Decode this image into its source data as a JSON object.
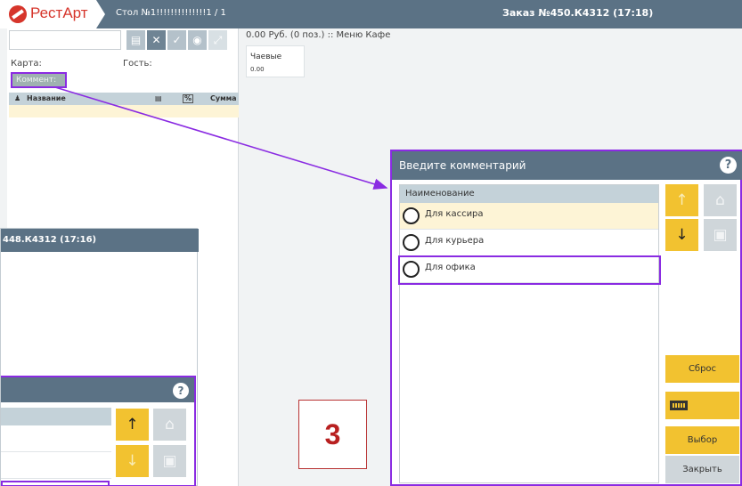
{
  "header": {
    "app_name": "РестАрт",
    "table_label": "Стол №1!!!!!!!!!!!!!!1 / 1",
    "order_title": "Заказ №450.К4312 (17:18)"
  },
  "order_panel": {
    "search_value": "",
    "card_label": "Карта:",
    "guest_label": "Гость:",
    "comment_button": "Коммент:",
    "columns": {
      "name": "Название",
      "percent": "%",
      "sum": "Сумма"
    }
  },
  "summary": {
    "text": "0.00 Руб. (0 поз.) :: Меню Кафе",
    "tips_label": "Чаевые",
    "tips_value": "0.00"
  },
  "window2": {
    "title": "448.К4312 (17:16)"
  },
  "dialog": {
    "title": "Введите комментарий",
    "list_header": "Наименование",
    "items": [
      {
        "label": "Для кассира"
      },
      {
        "label": "Для курьера"
      },
      {
        "label": "Для офика"
      }
    ],
    "reset_label": "Сброс",
    "select_label": "Выбор",
    "close_label": "Закрыть"
  },
  "callout_number": "3",
  "colors": {
    "header": "#5b7285",
    "highlight": "#8a2be2",
    "accent_yellow": "#f2c230",
    "brand_red": "#d6352b"
  },
  "icons": [
    "logo-icon",
    "calculator-icon",
    "close-icon",
    "check-icon",
    "eye-icon",
    "expand-icon",
    "person-icon",
    "help-icon",
    "arrow-up-icon",
    "arrow-down-icon",
    "home-icon",
    "folder-up-icon",
    "keyboard-icon"
  ]
}
